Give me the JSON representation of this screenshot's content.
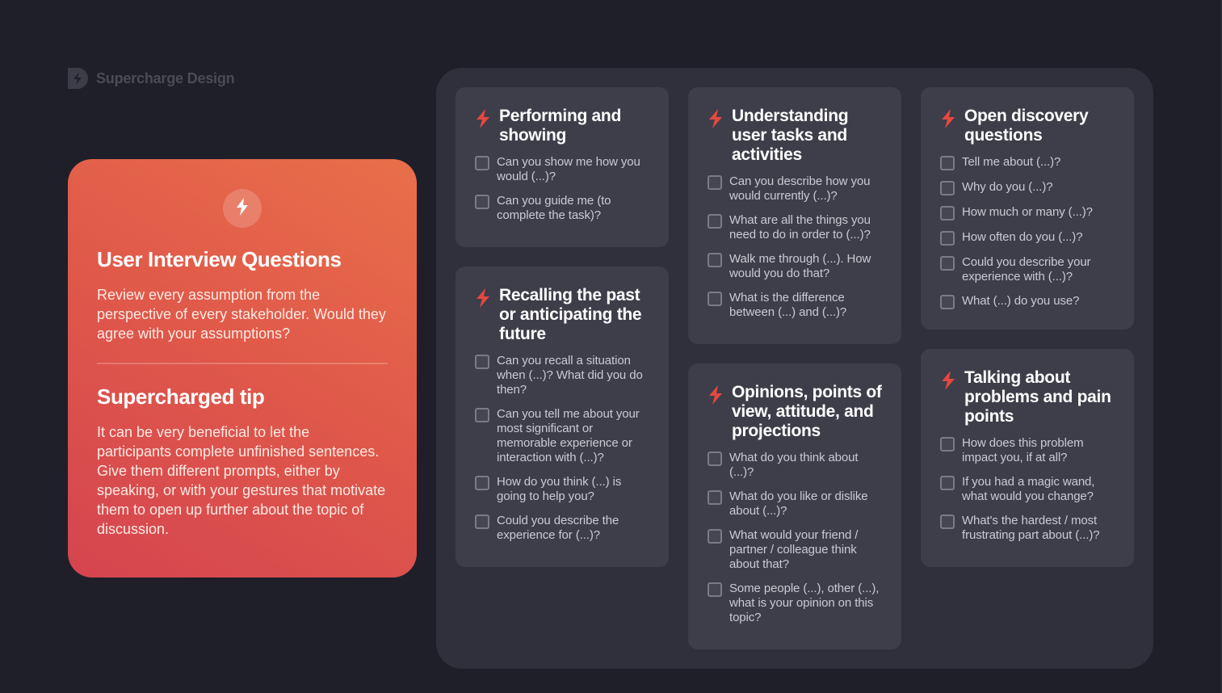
{
  "brand": {
    "name": "Supercharge Design",
    "logo_icon": "bolt-d-logo-icon"
  },
  "hero": {
    "icon": "lightning-bolt-icon",
    "title": "User Interview Questions",
    "description": "Review every assumption from the perspective of every stakeholder. Would they agree with your assumptions?",
    "tip_title": "Supercharged tip",
    "tip": "It can be very beneficial to let the participants complete unfinished sentences. Give them different prompts, either by speaking, or with your gestures that motivate them to open up further about the topic of discussion."
  },
  "colors": {
    "background": "#1f1f29",
    "panel": "#2f303b",
    "card": "#3d3e4a",
    "accent": "#e5483f",
    "hero_gradient_start": "#e96f4a",
    "hero_gradient_end": "#d5444f"
  },
  "categories": [
    {
      "title": "Performing and showing",
      "icon": "lightning-bolt-icon",
      "questions": [
        "Can you show me how you would (...)?",
        "Can you guide me (to complete the task)?"
      ]
    },
    {
      "title": "Recalling the past or anticipating the future",
      "icon": "lightning-bolt-icon",
      "questions": [
        "Can you recall a situation when (...)? What did you do then?",
        "Can you tell me about your most significant or memorable experience or interaction with (...)?",
        "How do you think (...) is going to help you?",
        "Could you describe the experience for (...)?"
      ]
    },
    {
      "title": "Understanding user tasks and activities",
      "icon": "lightning-bolt-icon",
      "questions": [
        "Can you describe how you would currently (...)?",
        "What are all the things you need to do in order to (...)?",
        "Walk me through (...). How would you do that?",
        "What is the difference between (...) and (...)?"
      ]
    },
    {
      "title": "Opinions, points of view, attitude, and projections",
      "icon": "lightning-bolt-icon",
      "questions": [
        "What do you think about (...)?",
        "What do you like or dislike about (...)?",
        "What would your friend / partner / colleague think about that?",
        "Some people (...), other (...), what is your opinion on this topic?"
      ]
    },
    {
      "title": "Open discovery questions",
      "icon": "lightning-bolt-icon",
      "questions": [
        "Tell me about (...)?",
        "Why do you (...)?",
        "How much or many (...)?",
        "How often do you (...)?",
        "Could you describe your experience with (...)?",
        "What (...) do you use?"
      ]
    },
    {
      "title": "Talking about problems and pain points",
      "icon": "lightning-bolt-icon",
      "questions": [
        "How does this problem impact you, if at all?",
        "If you had a magic wand, what would you change?",
        "What's the hardest / most frustrating part about (...)?"
      ]
    }
  ]
}
